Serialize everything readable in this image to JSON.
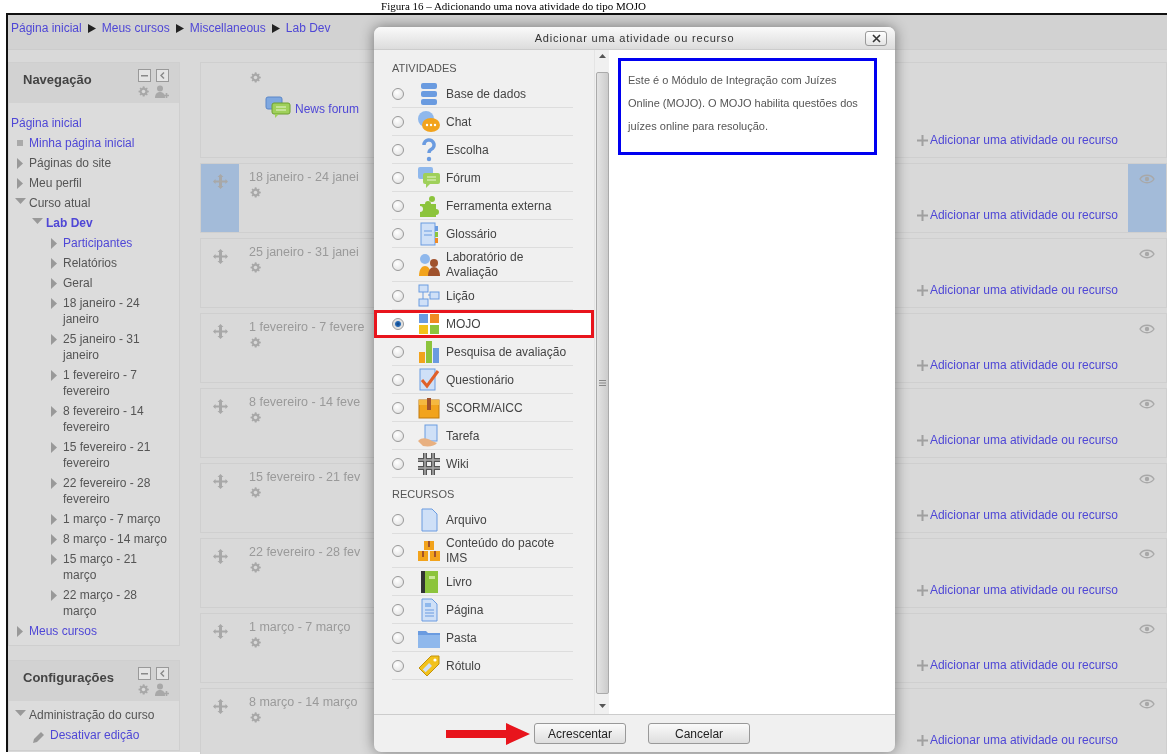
{
  "caption": "Figura 16 – Adicionando uma nova atividade do tipo MOJO",
  "breadcrumb": [
    "Página inicial",
    "Meus cursos",
    "Miscellaneous",
    "Lab Dev"
  ],
  "blocks": [
    {
      "title": "Navegação",
      "items": [
        {
          "label": "Página inicial",
          "kind": "plain",
          "link": true
        },
        {
          "label": "Minha página inicial",
          "kind": "leaf",
          "link": true
        },
        {
          "label": "Páginas do site",
          "kind": "branch",
          "expanded": false,
          "link": false
        },
        {
          "label": "Meu perfil",
          "kind": "branch",
          "expanded": false,
          "link": false
        },
        {
          "label": "Curso atual",
          "kind": "branch",
          "expanded": true,
          "link": false,
          "children": [
            {
              "label": "Lab Dev",
              "kind": "branch",
              "expanded": true,
              "link": true,
              "children": [
                {
                  "label": "Participantes",
                  "kind": "branch",
                  "expanded": false,
                  "link": true
                },
                {
                  "label": "Relatórios",
                  "kind": "branch",
                  "expanded": false,
                  "link": false
                },
                {
                  "label": "Geral",
                  "kind": "branch",
                  "expanded": false,
                  "link": false
                },
                {
                  "label": "18 janeiro - 24 janeiro",
                  "kind": "branch",
                  "expanded": false,
                  "link": false
                },
                {
                  "label": "25 janeiro - 31 janeiro",
                  "kind": "branch",
                  "expanded": false,
                  "link": false
                },
                {
                  "label": "1 fevereiro - 7 fevereiro",
                  "kind": "branch",
                  "expanded": false,
                  "link": false
                },
                {
                  "label": "8 fevereiro - 14 fevereiro",
                  "kind": "branch",
                  "expanded": false,
                  "link": false
                },
                {
                  "label": "15 fevereiro - 21 fevereiro",
                  "kind": "branch",
                  "expanded": false,
                  "link": false
                },
                {
                  "label": "22 fevereiro - 28 fevereiro",
                  "kind": "branch",
                  "expanded": false,
                  "link": false
                },
                {
                  "label": "1 março - 7 março",
                  "kind": "branch",
                  "expanded": false,
                  "link": false
                },
                {
                  "label": "8 março - 14 março",
                  "kind": "branch",
                  "expanded": false,
                  "link": false
                },
                {
                  "label": "15 março - 21 março",
                  "kind": "branch",
                  "expanded": false,
                  "link": false
                },
                {
                  "label": "22 março - 28 março",
                  "kind": "branch",
                  "expanded": false,
                  "link": false
                }
              ]
            }
          ]
        },
        {
          "label": "Meus cursos",
          "kind": "branch",
          "expanded": false,
          "link": true
        }
      ]
    },
    {
      "title": "Configurações",
      "items": [
        {
          "label": "Administração do curso",
          "kind": "branch",
          "expanded": true,
          "link": false,
          "children": [
            {
              "label": "Desativar edição",
              "kind": "action",
              "link": true
            }
          ]
        }
      ]
    }
  ],
  "sections": [
    {
      "kind": "general",
      "activities": [
        {
          "label": "News forum"
        }
      ],
      "add_link": "Adicionar uma atividade ou recurso",
      "current": false
    },
    {
      "kind": "week",
      "title": "18 janeiro - 24 janei",
      "add_link": "Adicionar uma atividade ou recurso",
      "current": true
    },
    {
      "kind": "week",
      "title": "25 janeiro - 31 janei",
      "add_link": "Adicionar uma atividade ou recurso",
      "current": false
    },
    {
      "kind": "week",
      "title": "1 fevereiro - 7 fevere",
      "add_link": "Adicionar uma atividade ou recurso",
      "current": false
    },
    {
      "kind": "week",
      "title": "8 fevereiro - 14 feve",
      "add_link": "Adicionar uma atividade ou recurso",
      "current": false
    },
    {
      "kind": "week",
      "title": "15 fevereiro - 21 fev",
      "add_link": "Adicionar uma atividade ou recurso",
      "current": false
    },
    {
      "kind": "week",
      "title": "22 fevereiro - 28 fev",
      "add_link": "Adicionar uma atividade ou recurso",
      "current": false
    },
    {
      "kind": "week",
      "title": "1 março - 7 março",
      "add_link": "Adicionar uma atividade ou recurso",
      "current": false
    },
    {
      "kind": "week",
      "title": "8 março - 14 março",
      "add_link": "Adicionar uma atividade ou recurso",
      "current": false
    }
  ],
  "dialog": {
    "title": "Adicionar uma atividade ou recurso",
    "groups": [
      {
        "heading": "ATIVIDADES",
        "options": [
          {
            "label": "Base de dados",
            "selected": false
          },
          {
            "label": "Chat",
            "selected": false
          },
          {
            "label": "Escolha",
            "selected": false
          },
          {
            "label": "Fórum",
            "selected": false
          },
          {
            "label": "Ferramenta externa",
            "selected": false
          },
          {
            "label": "Glossário",
            "selected": false
          },
          {
            "label": "Laboratório de Avaliação",
            "selected": false
          },
          {
            "label": "Lição",
            "selected": false
          },
          {
            "label": "MOJO",
            "selected": true
          },
          {
            "label": "Pesquisa de avaliação",
            "selected": false
          },
          {
            "label": "Questionário",
            "selected": false
          },
          {
            "label": "SCORM/AICC",
            "selected": false
          },
          {
            "label": "Tarefa",
            "selected": false
          },
          {
            "label": "Wiki",
            "selected": false
          }
        ]
      },
      {
        "heading": "RECURSOS",
        "options": [
          {
            "label": "Arquivo",
            "selected": false
          },
          {
            "label": "Conteúdo do pacote IMS",
            "selected": false
          },
          {
            "label": "Livro",
            "selected": false
          },
          {
            "label": "Página",
            "selected": false
          },
          {
            "label": "Pasta",
            "selected": false
          },
          {
            "label": "Rótulo",
            "selected": false
          }
        ]
      }
    ],
    "description": "Este é o Módulo de Integração com Juízes Online (MOJO). O MOJO habilita questões dos juízes online para resolução.",
    "buttons": [
      "Acrescentar",
      "Cancelar"
    ]
  }
}
